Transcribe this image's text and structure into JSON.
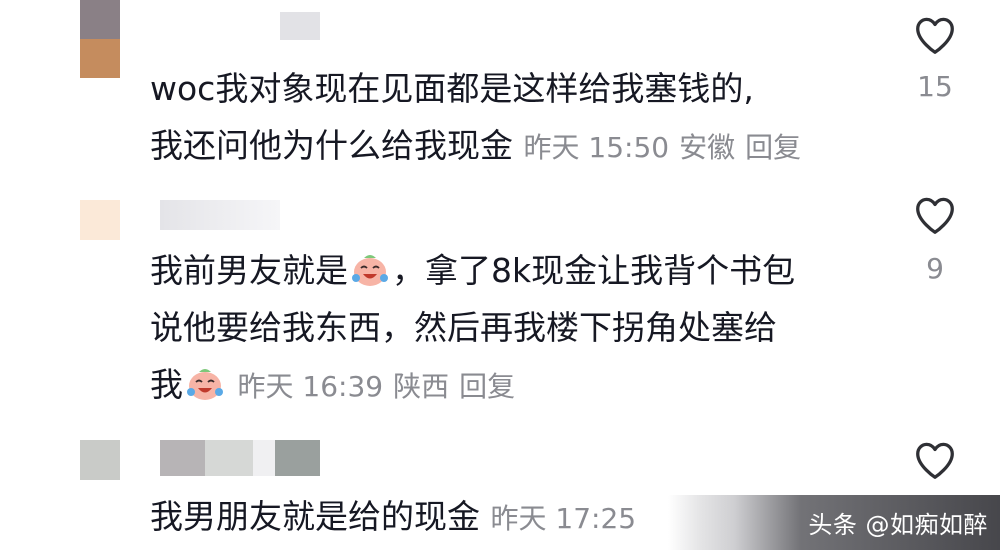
{
  "comments": [
    {
      "lines": [
        "woc我对象现在见面都是这样给我塞钱的,",
        "我还问他为什么给我现金"
      ],
      "time": "昨天 15:50",
      "location": "安徽",
      "reply": "回复",
      "likes": "15"
    },
    {
      "line1_before": "我前男友就是",
      "line1_after": "，拿了8k现金让我背个书包",
      "line2": "说他要给我东西，然后再我楼下拐角处塞给",
      "line3": "我",
      "emoji_name": "laughing-crying-emoji",
      "time": "昨天 16:39",
      "location": "陕西",
      "reply": "回复",
      "likes": "9"
    },
    {
      "line": "我男朋友就是给的现金",
      "time": "昨天 17:25"
    }
  ],
  "watermark": "头条 @如痴如醉",
  "colors": {
    "text": "#161823",
    "meta": "#8a8b91",
    "icon": "#2f3035"
  }
}
